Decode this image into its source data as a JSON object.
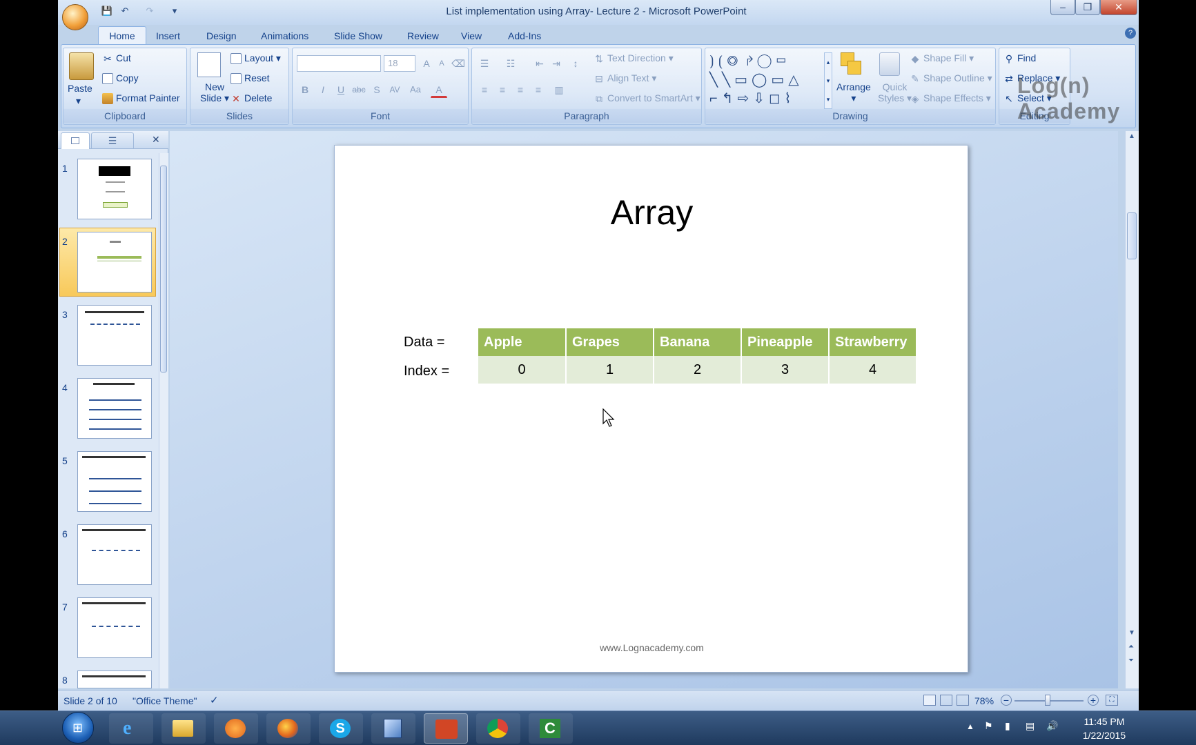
{
  "window": {
    "title": "List implementation using Array- Lecture 2 - Microsoft PowerPoint"
  },
  "tabs": [
    "Home",
    "Insert",
    "Design",
    "Animations",
    "Slide Show",
    "Review",
    "View",
    "Add-Ins"
  ],
  "ribbon": {
    "clipboard": {
      "label": "Clipboard",
      "paste": "Paste",
      "cut": "Cut",
      "copy": "Copy",
      "format_painter": "Format Painter"
    },
    "slides": {
      "label": "Slides",
      "new_slide_1": "New",
      "new_slide_2": "Slide",
      "layout": "Layout",
      "reset": "Reset",
      "delete": "Delete"
    },
    "font": {
      "label": "Font",
      "size": "18"
    },
    "paragraph": {
      "label": "Paragraph",
      "text_direction": "Text Direction",
      "align_text": "Align Text",
      "convert_smartart": "Convert to SmartArt"
    },
    "drawing": {
      "label": "Drawing",
      "arrange": "Arrange",
      "quick_styles_1": "Quick",
      "quick_styles_2": "Styles",
      "shape_fill": "Shape Fill",
      "shape_outline": "Shape Outline",
      "shape_effects": "Shape Effects"
    },
    "editing": {
      "label": "Editing",
      "find": "Find",
      "replace": "Replace",
      "select": "Select"
    }
  },
  "watermark": "Log(n) Academy",
  "thumbnails": [
    {
      "num": "1"
    },
    {
      "num": "2"
    },
    {
      "num": "3"
    },
    {
      "num": "4"
    },
    {
      "num": "5"
    },
    {
      "num": "6"
    },
    {
      "num": "7"
    },
    {
      "num": "8"
    }
  ],
  "slide": {
    "title": "Array",
    "data_label": "Data =",
    "index_label": "Index =",
    "data": [
      "Apple",
      "Grapes",
      "Banana",
      "Pineapple",
      "Strawberry"
    ],
    "index": [
      "0",
      "1",
      "2",
      "3",
      "4"
    ],
    "footer": "www.Lognacademy.com"
  },
  "status": {
    "slide_info": "Slide 2 of 10",
    "theme": "\"Office Theme\"",
    "zoom": "78%"
  },
  "clock": {
    "time": "11:45 PM",
    "date": "1/22/2015"
  },
  "colors": {
    "header_green": "#9bbb59",
    "index_row": "#e3ecd8"
  }
}
